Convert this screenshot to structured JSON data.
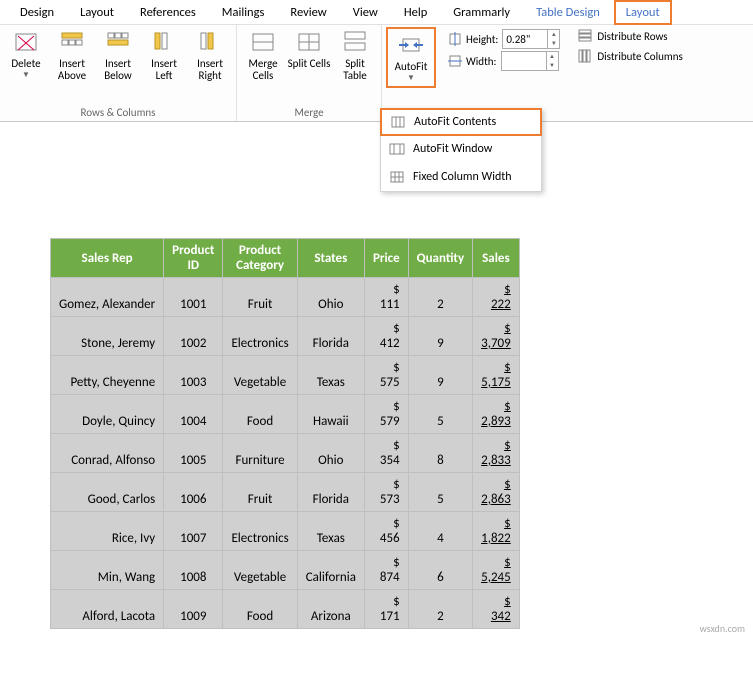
{
  "tabs": {
    "design": "Design",
    "layout": "Layout",
    "references": "References",
    "mailings": "Mailings",
    "review": "Review",
    "view": "View",
    "help": "Help",
    "grammarly": "Grammarly",
    "tabledesign": "Table Design",
    "layout2": "Layout"
  },
  "ribbon": {
    "delete": "Delete",
    "insertAbove": "Insert\nAbove",
    "insertBelow": "Insert\nBelow",
    "insertLeft": "Insert\nLeft",
    "insertRight": "Insert\nRight",
    "mergeCells": "Merge\nCells",
    "splitCells": "Split\nCells",
    "splitTable": "Split\nTable",
    "autofit": "AutoFit",
    "groupRowsCols": "Rows & Columns",
    "groupMerge": "Merge",
    "heightLbl": "Height:",
    "widthLbl": "Width:",
    "heightVal": "0.28\"",
    "widthVal": "",
    "distRows": "Distribute Rows",
    "distCols": "Distribute Columns"
  },
  "menu": {
    "autofitContents": "AutoFit Contents",
    "autofitWindow": "AutoFit Window",
    "fixedWidth": "Fixed Column Width"
  },
  "table": {
    "headers": [
      "Sales Rep",
      "Product ID",
      "Product Category",
      "States",
      "Price",
      "Quantity",
      "Sales"
    ],
    "rows": [
      {
        "rep": "Gomez, Alexander",
        "pid": "1001",
        "cat": "Fruit",
        "st": "Ohio",
        "price": "111",
        "qty": "2",
        "sales": "222"
      },
      {
        "rep": "Stone, Jeremy",
        "pid": "1002",
        "cat": "Electronics",
        "st": "Florida",
        "price": "412",
        "qty": "9",
        "sales": "3,709"
      },
      {
        "rep": "Petty, Cheyenne",
        "pid": "1003",
        "cat": "Vegetable",
        "st": "Texas",
        "price": "575",
        "qty": "9",
        "sales": "5,175"
      },
      {
        "rep": "Doyle, Quincy",
        "pid": "1004",
        "cat": "Food",
        "st": "Hawaii",
        "price": "579",
        "qty": "5",
        "sales": "2,893"
      },
      {
        "rep": "Conrad, Alfonso",
        "pid": "1005",
        "cat": "Furniture",
        "st": "Ohio",
        "price": "354",
        "qty": "8",
        "sales": "2,833"
      },
      {
        "rep": "Good, Carlos",
        "pid": "1006",
        "cat": "Fruit",
        "st": "Florida",
        "price": "573",
        "qty": "5",
        "sales": "2,863"
      },
      {
        "rep": "Rice, Ivy",
        "pid": "1007",
        "cat": "Electronics",
        "st": "Texas",
        "price": "456",
        "qty": "4",
        "sales": "1,822"
      },
      {
        "rep": "Min, Wang",
        "pid": "1008",
        "cat": "Vegetable",
        "st": "California",
        "price": "874",
        "qty": "6",
        "sales": "5,245"
      },
      {
        "rep": "Alford, Lacota",
        "pid": "1009",
        "cat": "Food",
        "st": "Arizona",
        "price": "171",
        "qty": "2",
        "sales": "342"
      }
    ]
  },
  "watermark": "wsxdn.com"
}
